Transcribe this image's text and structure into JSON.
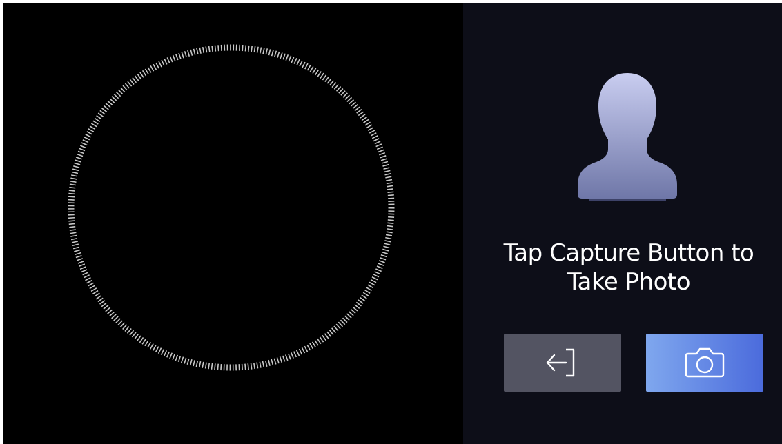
{
  "prompt": {
    "line1": "Tap Capture Button to",
    "line2": "Take Photo"
  },
  "icons": {
    "avatar": "person-silhouette-icon",
    "exit": "exit-arrow-icon",
    "capture": "camera-icon",
    "face_frame": "dotted-circle-frame"
  },
  "colors": {
    "camera_background": "#000000",
    "panel_background": "#0d0e18",
    "exit_button": "#535462",
    "capture_button_start": "#7fa7ee",
    "capture_button_end": "#4b6bdc",
    "ring": "#c8c8c8",
    "text": "#ffffff"
  }
}
